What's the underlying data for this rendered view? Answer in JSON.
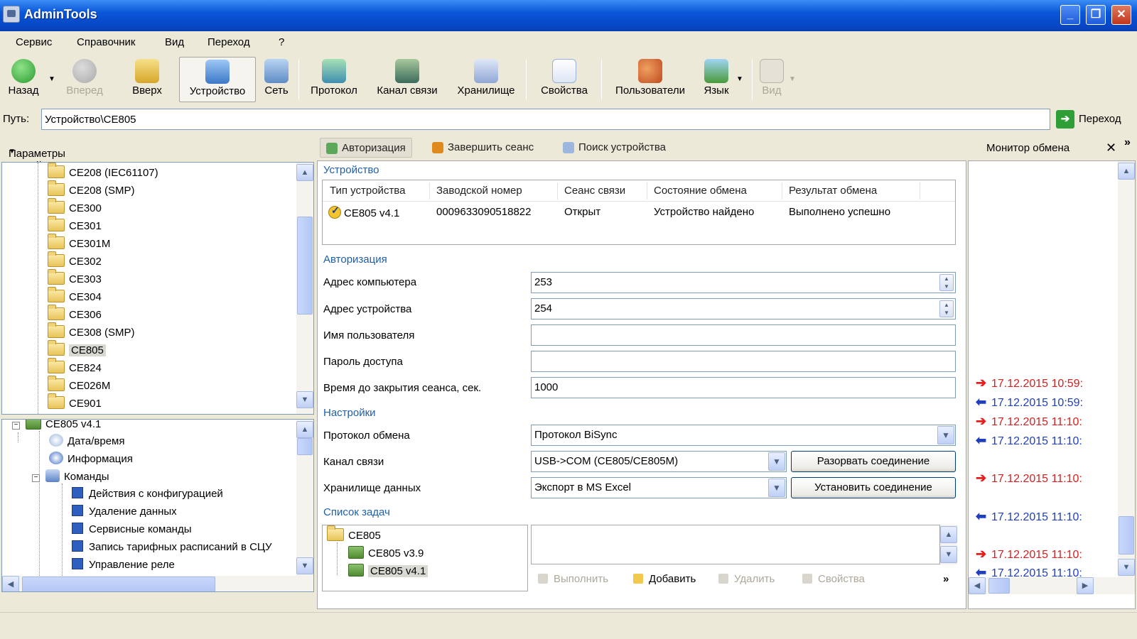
{
  "window": {
    "title": "AdminTools"
  },
  "menu": [
    "Сервис",
    "Справочник",
    "Вид",
    "Переход",
    "?"
  ],
  "toolbar": {
    "back": "Назад",
    "forward": "Вперед",
    "up": "Вверх",
    "device": "Устройство",
    "network": "Сеть",
    "protocol": "Протокол",
    "channel": "Канал связи",
    "storage": "Хранилище",
    "properties": "Свойства",
    "users": "Пользователи",
    "language": "Язык",
    "view": "Вид"
  },
  "path": {
    "label": "Путь:",
    "value": "Устройство\\CE805",
    "go_label": "Переход"
  },
  "left_panel": {
    "header": "Параметры устройств",
    "devices": [
      "CE208 (IEC61107)",
      "CE208 (SMP)",
      "CE300",
      "CE301",
      "CE301M",
      "CE302",
      "CE303",
      "CE304",
      "CE306",
      "CE308 (SMP)",
      "CE805",
      "CE824",
      "CE026M",
      "CE901"
    ],
    "selected_device": "CE805",
    "cmd_tree": {
      "root": "CE805 v4.1",
      "datetime": "Дата/время",
      "info": "Информация",
      "commands": "Команды",
      "items": [
        "Действия с конфигурацией",
        "Удаление данных",
        "Сервисные команды",
        "Запись тарифных расписаний в СЦУ",
        "Управление реле"
      ]
    }
  },
  "tabs": {
    "auth": "Авторизация",
    "end_session": "Завершить сеанс",
    "find_device": "Поиск устройства"
  },
  "device_section": {
    "title": "Устройство",
    "columns": [
      "Тип устройства",
      "Заводской номер",
      "Сеанс связи",
      "Состояние обмена",
      "Результат обмена"
    ],
    "row": {
      "type": "CE805 v4.1",
      "serial": "0009633090518822",
      "session": "Открыт",
      "state": "Устройство найдено",
      "result": "Выполнено успешно"
    }
  },
  "auth_section": {
    "title": "Авторизация",
    "computer_address_label": "Адрес компьютера",
    "computer_address": "253",
    "device_address_label": "Адрес устройства",
    "device_address": "254",
    "username_label": "Имя пользователя",
    "username": "",
    "password_label": "Пароль доступа",
    "password": "",
    "timeout_label": "Время до закрытия сеанса, сек.",
    "timeout": "1000"
  },
  "settings_section": {
    "title": "Настройки",
    "protocol_label": "Протокол обмена",
    "protocol": "Протокол BiSync",
    "channel_label": "Канал связи",
    "channel": "USB->COM (CE805/CE805M)",
    "storage_label": "Хранилище данных",
    "storage": "Экспорт в MS Excel",
    "disconnect_button": "Разорвать соединение",
    "connect_button": "Установить соединение"
  },
  "tasks_section": {
    "title": "Список задач",
    "tree_root": "CE805",
    "tree_items": [
      "CE805 v3.9",
      "CE805 v4.1"
    ],
    "actions": {
      "run": "Выполнить",
      "add": "Добавить",
      "delete": "Удалить",
      "properties": "Свойства"
    }
  },
  "monitor": {
    "title": "Монитор обмена",
    "entries": [
      {
        "dir": "out",
        "text": "17.12.2015 10:59:"
      },
      {
        "dir": "in",
        "text": "17.12.2015 10:59:"
      },
      {
        "dir": "out",
        "text": "17.12.2015 11:10:"
      },
      {
        "dir": "in",
        "text": "17.12.2015 11:10:"
      },
      {
        "dir": "out",
        "text": "17.12.2015 11:10:"
      },
      {
        "dir": "in",
        "text": "17.12.2015 11:10:"
      },
      {
        "dir": "out",
        "text": "17.12.2015 11:10:"
      },
      {
        "dir": "in",
        "text": "17.12.2015 11:10:"
      }
    ]
  },
  "colors": {
    "title_bar": "#0A56D8",
    "section_title": "#1F5FA8",
    "log_out": "#D81E1E",
    "log_in": "#1F3FBF",
    "window_bg": "#ECE9D8"
  }
}
